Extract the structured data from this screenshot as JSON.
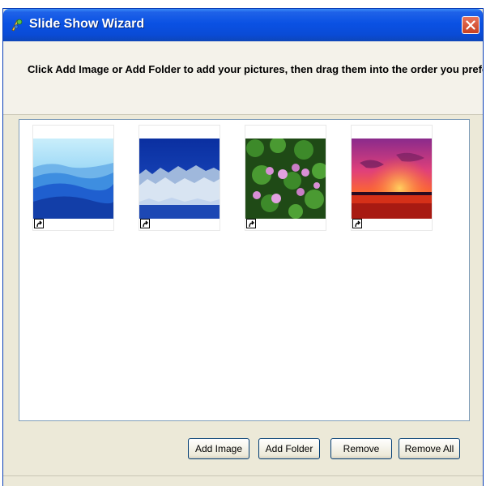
{
  "window": {
    "title": "Slide Show Wizard",
    "icon": "wizard-app-icon",
    "close_icon": "close-icon"
  },
  "header": {
    "instruction": "Click Add Image or Add Folder to add your pictures, then drag them into the order you prefer."
  },
  "pictures": [
    {
      "name": "blue-hills",
      "shortcut_icon": "shortcut-arrow-icon"
    },
    {
      "name": "winter-forest",
      "shortcut_icon": "shortcut-arrow-icon"
    },
    {
      "name": "water-lilies",
      "shortcut_icon": "shortcut-arrow-icon"
    },
    {
      "name": "sunset",
      "shortcut_icon": "shortcut-arrow-icon"
    }
  ],
  "buttons": {
    "add_image": "Add Image",
    "add_folder": "Add Folder",
    "remove": "Remove",
    "remove_all": "Remove All"
  },
  "colors": {
    "titlebar": "#0a51e3",
    "close_button": "#c8401f",
    "window_bg": "#ece9d8"
  }
}
